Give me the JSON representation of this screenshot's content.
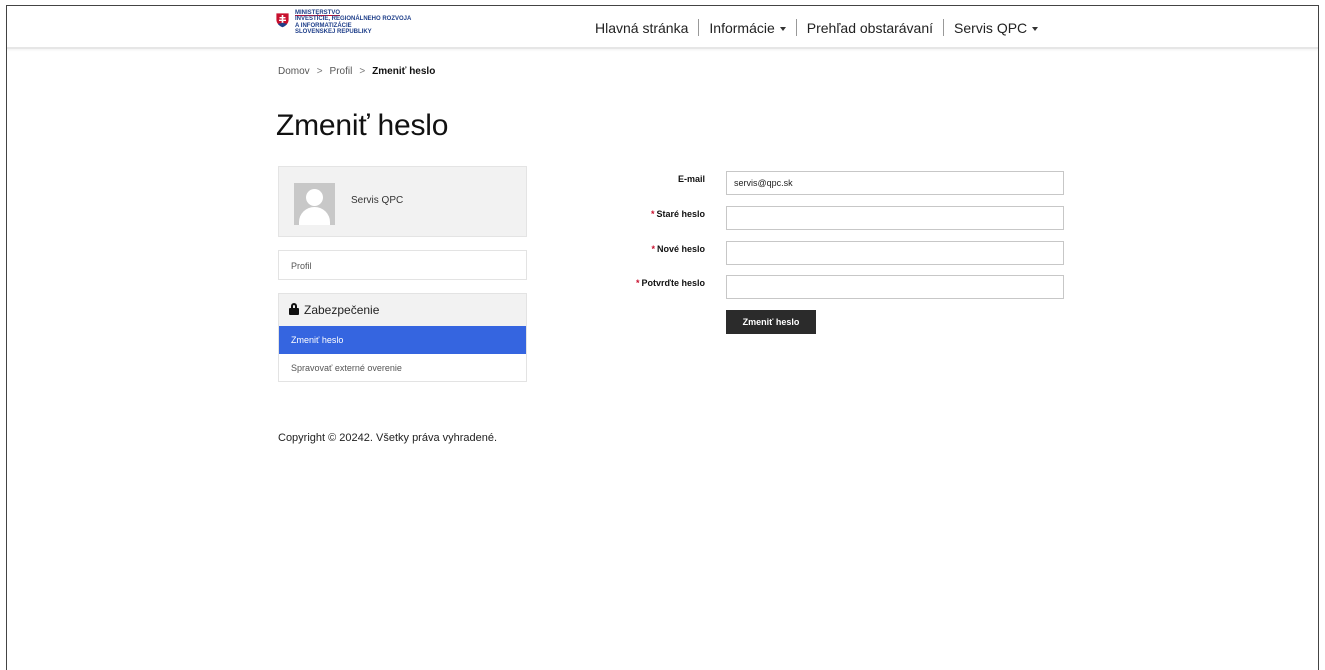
{
  "header": {
    "logo_lines": [
      "Ministerstvo",
      "investície, regionálneho rozvoja",
      "a informatizácie",
      "Slovenskej republiky"
    ],
    "nav": [
      {
        "label": "Hlavná stránka",
        "has_dropdown": false
      },
      {
        "label": "Informácie",
        "has_dropdown": true
      },
      {
        "label": "Prehľad obstarávaní",
        "has_dropdown": false
      },
      {
        "label": "Servis QPC",
        "has_dropdown": true
      }
    ]
  },
  "breadcrumb": {
    "items": [
      "Domov",
      "Profil"
    ],
    "separator": ">",
    "current": "Zmeniť heslo"
  },
  "page_title": "Zmeniť heslo",
  "profile": {
    "name": "Servis QPC"
  },
  "sidebar": {
    "profile_link": "Profil",
    "security_heading": "Zabezpečenie",
    "security_items": [
      {
        "label": "Zmeniť heslo",
        "active": true
      },
      {
        "label": "Spravovať externé overenie",
        "active": false
      }
    ]
  },
  "form": {
    "email_label": "E-mail",
    "email_value": "servis@qpc.sk",
    "required_mark": "*",
    "old_password_label": "Staré heslo",
    "new_password_label": "Nové heslo",
    "confirm_password_label": "Potvrďte heslo",
    "submit_label": "Zmeniť heslo"
  },
  "footer": {
    "copyright": "Copyright © 20242. Všetky práva vyhradené."
  },
  "colors": {
    "accent": "#3565e0",
    "button": "#2b2b2b",
    "required": "#c8102e",
    "brand": "#1f3f8a"
  }
}
